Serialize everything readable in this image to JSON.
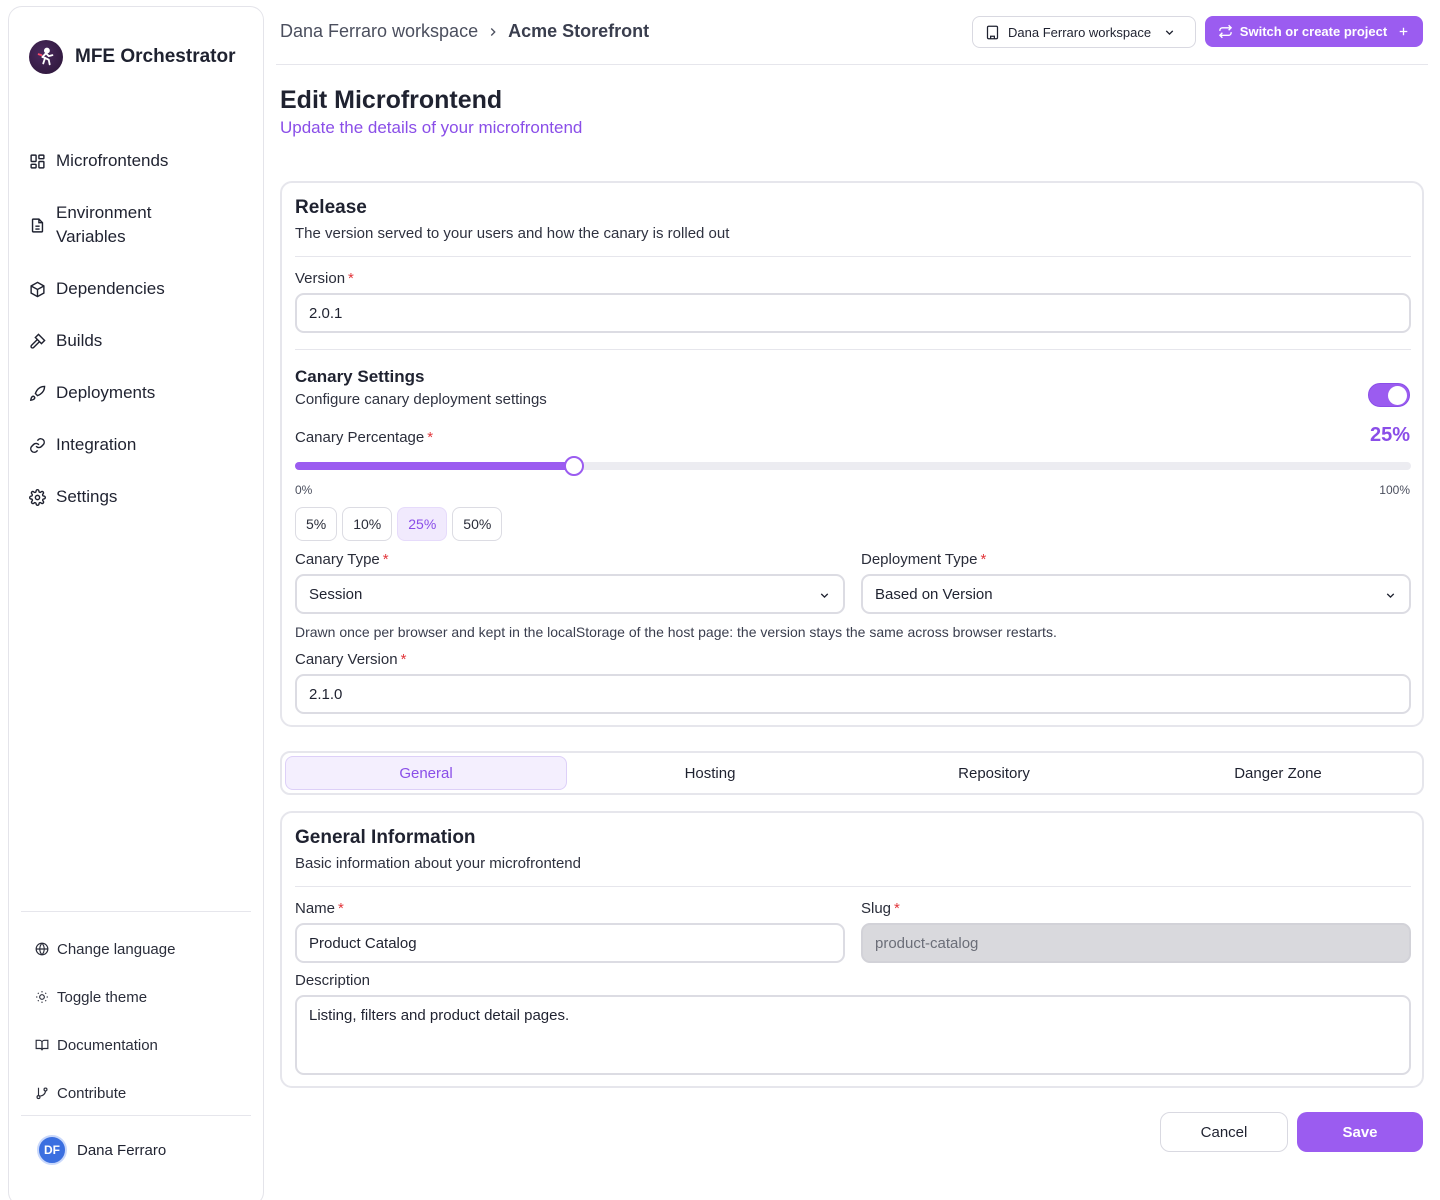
{
  "brand": {
    "title": "MFE Orchestrator",
    "logo_icon": "rocket-person-icon"
  },
  "sidebar": {
    "items": [
      {
        "label": "Microfrontends",
        "icon": "grid-icon"
      },
      {
        "label": "Environment Variables",
        "icon": "file-text-icon"
      },
      {
        "label": "Dependencies",
        "icon": "package-icon"
      },
      {
        "label": "Builds",
        "icon": "hammer-icon"
      },
      {
        "label": "Deployments",
        "icon": "rocket-icon"
      },
      {
        "label": "Integration",
        "icon": "link-icon"
      },
      {
        "label": "Settings",
        "icon": "gear-icon"
      }
    ],
    "utilities": [
      {
        "label": "Change language",
        "icon": "globe-icon"
      },
      {
        "label": "Toggle theme",
        "icon": "sun-icon"
      },
      {
        "label": "Documentation",
        "icon": "book-icon"
      },
      {
        "label": "Contribute",
        "icon": "git-branch-icon"
      }
    ],
    "user": {
      "initials": "DF",
      "name": "Dana Ferraro"
    }
  },
  "header": {
    "breadcrumb_workspace": "Dana Ferraro workspace",
    "breadcrumb_project": "Acme Storefront",
    "workspace_select": "Dana Ferraro workspace",
    "switch_button": "Switch or create project"
  },
  "page": {
    "title": "Edit Microfrontend",
    "subtitle": "Update the details of your microfrontend"
  },
  "release": {
    "title": "Release",
    "description": "The version served to your users and how the canary is rolled out",
    "version_label": "Version",
    "version_value": "2.0.1",
    "canary": {
      "title": "Canary Settings",
      "description": "Configure canary deployment settings",
      "enabled": true,
      "percentage_label": "Canary Percentage",
      "percentage_value": 25,
      "percentage_display": "25%",
      "min_label": "0%",
      "max_label": "100%",
      "presets": [
        "5%",
        "10%",
        "25%",
        "50%"
      ],
      "active_preset": "25%",
      "canary_type_label": "Canary Type",
      "canary_type_value": "Session",
      "deployment_type_label": "Deployment Type",
      "deployment_type_value": "Based on Version",
      "help_text": "Drawn once per browser and kept in the localStorage of the host page: the version stays the same across browser restarts.",
      "canary_version_label": "Canary Version",
      "canary_version_value": "2.1.0"
    }
  },
  "tabs": [
    "General",
    "Hosting",
    "Repository",
    "Danger Zone"
  ],
  "active_tab": "General",
  "general": {
    "title": "General Information",
    "description": "Basic information about your microfrontend",
    "name_label": "Name",
    "name_value": "Product Catalog",
    "slug_label": "Slug",
    "slug_value": "product-catalog",
    "description_label": "Description",
    "description_value": "Listing, filters and product detail pages."
  },
  "actions": {
    "cancel": "Cancel",
    "save": "Save"
  },
  "colors": {
    "accent": "#9b5cf0",
    "accent_text": "#8a4ee8",
    "required": "#e2363b"
  }
}
